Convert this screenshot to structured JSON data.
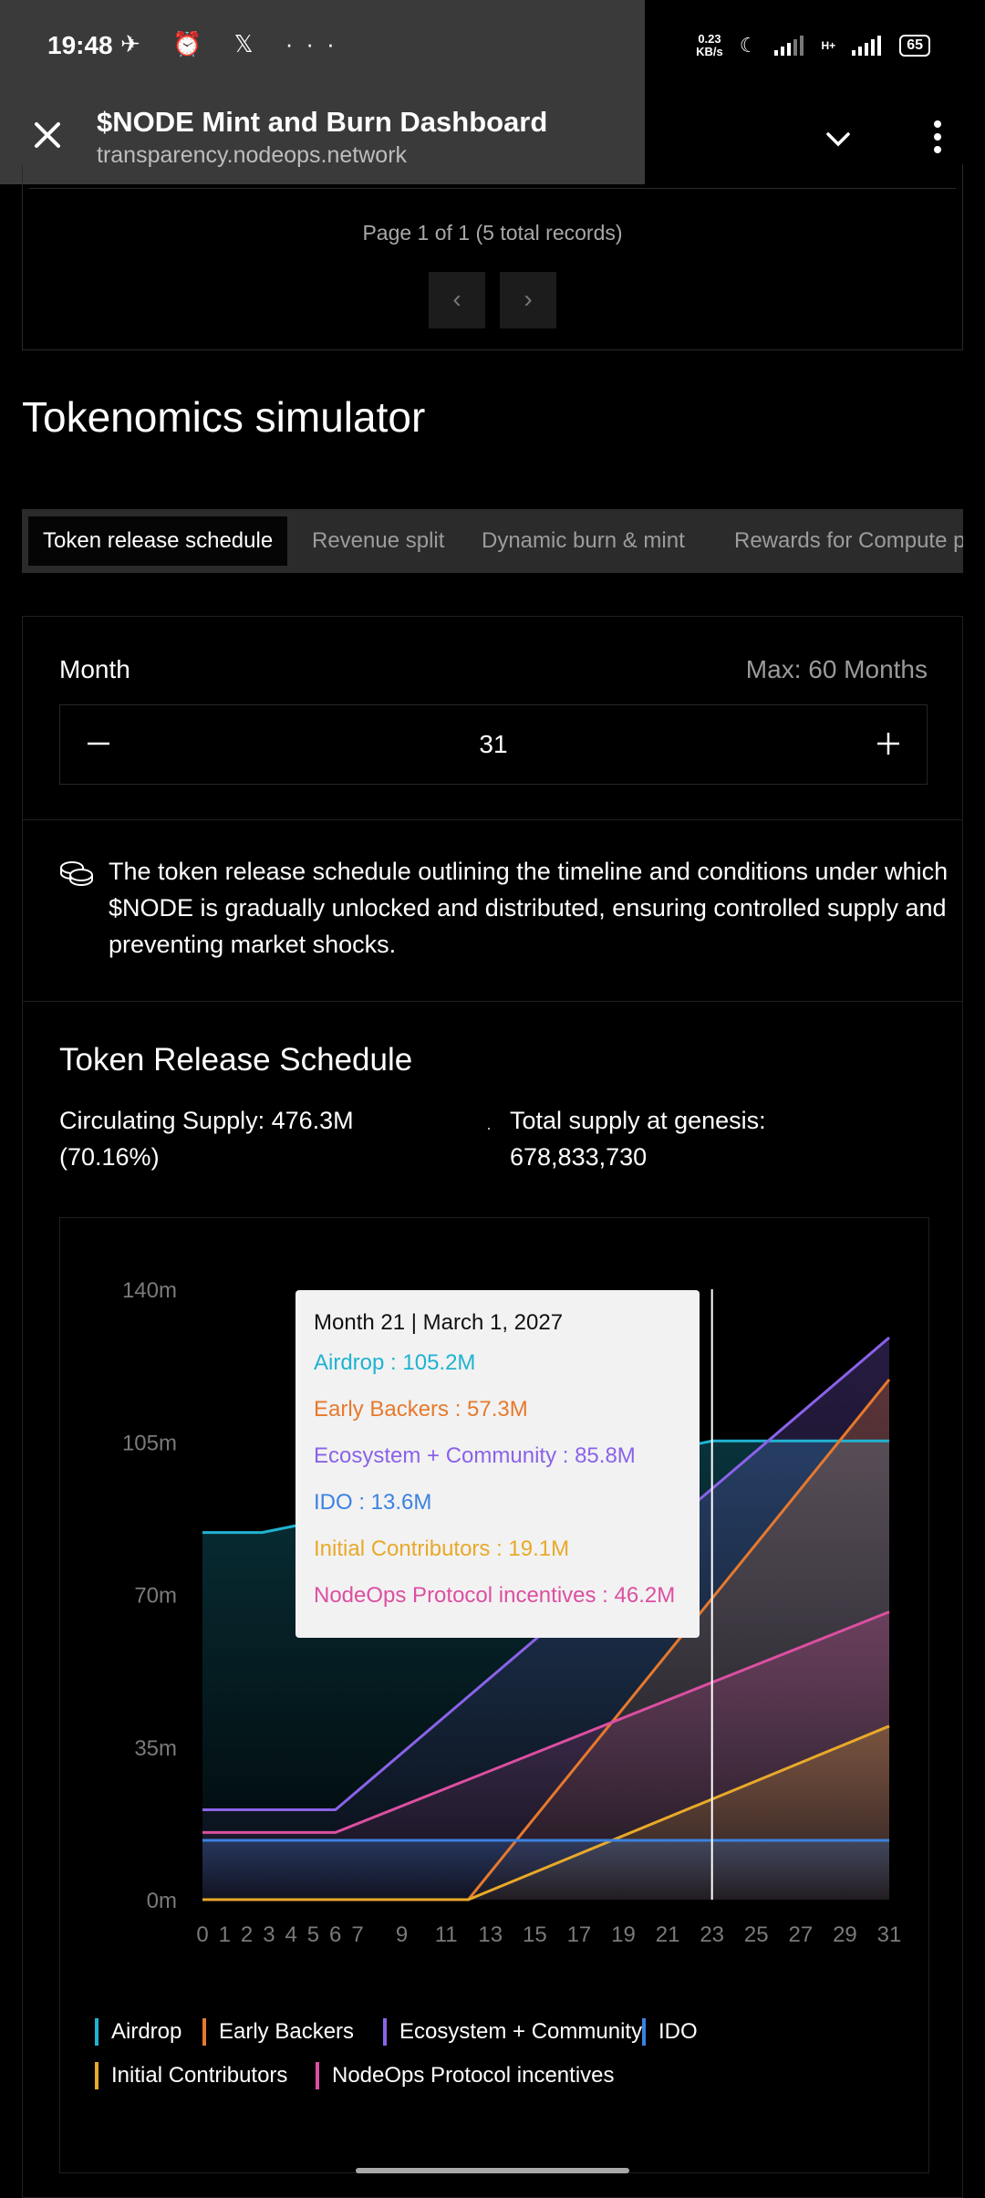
{
  "status_bar": {
    "time": "19:48",
    "icons": "✈ ⏰ 𝕏 ···",
    "speed_top": "0.23",
    "speed_bottom": "KB/s",
    "network": "H+",
    "battery": "65"
  },
  "browser": {
    "title": "$NODE Mint and Burn Dashboard",
    "url": "transparency.nodeops.network"
  },
  "pagination": {
    "info": "Page 1 of 1 (5 total records)",
    "prev": "‹",
    "next": "›"
  },
  "simulator": {
    "title": "Tokenomics simulator",
    "tabs": [
      "Token release schedule",
      "Revenue split",
      "Dynamic burn & mint",
      "Rewards for Compute p"
    ],
    "month_label": "Month",
    "month_max": "Max: 60 Months",
    "month_value": "31",
    "description": "The token release schedule outlining the timeline and conditions under which $NODE is gradually unlocked and distributed, ensuring controlled supply and preventing market shocks."
  },
  "release": {
    "title": "Token Release Schedule",
    "circulating": "Circulating Supply: 476.3M (70.16%)",
    "separator": "·",
    "genesis": "Total supply at genesis: 678,833,730"
  },
  "tooltip": {
    "header": "Month 21 | March 1, 2027",
    "rows": [
      {
        "text": "Airdrop : 105.2M",
        "color": "#1fb3d1"
      },
      {
        "text": "Early Backers : 57.3M",
        "color": "#e7792d"
      },
      {
        "text": "Ecosystem + Community : 85.8M",
        "color": "#8a63e8"
      },
      {
        "text": "IDO : 13.6M",
        "color": "#3b82e0"
      },
      {
        "text": "Initial Contributors : 19.1M",
        "color": "#e9a92a"
      },
      {
        "text": "NodeOps Protocol incentives : 46.2M",
        "color": "#dc4fa1"
      }
    ]
  },
  "chart_data": {
    "type": "area",
    "title": "Token Release Schedule",
    "x_ticks": [
      "0",
      "1",
      "2",
      "3",
      "4",
      "5",
      "6",
      "7",
      "9",
      "11",
      "13",
      "15",
      "17",
      "19",
      "21",
      "23",
      "25",
      "27",
      "29",
      "31"
    ],
    "y_ticks": [
      "140m",
      "105m",
      "70m",
      "35m",
      "0m"
    ],
    "ylim": [
      0,
      140
    ],
    "xlim": [
      0,
      31
    ],
    "hover_x": 23,
    "series": [
      {
        "name": "Airdrop",
        "color": "#1fb3d1",
        "x": [
          0,
          2.7,
          23,
          31
        ],
        "values": [
          84.2,
          84.2,
          105.2,
          105.2
        ]
      },
      {
        "name": "Early Backers",
        "color": "#e7792d",
        "x": [
          0,
          12,
          31
        ],
        "values": [
          0,
          0,
          119.3
        ]
      },
      {
        "name": "Ecosystem + Community",
        "color": "#8a63e8",
        "x": [
          0,
          6,
          31
        ],
        "values": [
          20.6,
          20.6,
          128.9
        ]
      },
      {
        "name": "IDO",
        "color": "#3b82e0",
        "x": [
          0,
          31
        ],
        "values": [
          13.6,
          13.6
        ]
      },
      {
        "name": "Initial Contributors",
        "color": "#e9a92a",
        "x": [
          0,
          12,
          31
        ],
        "values": [
          0,
          0,
          39.8
        ]
      },
      {
        "name": "NodeOps Protocol incentives",
        "color": "#dc4fa1",
        "x": [
          0,
          6,
          31
        ],
        "values": [
          15.4,
          15.4,
          66.0
        ]
      }
    ],
    "grid": false,
    "legend_position": "bottom"
  },
  "legend": [
    {
      "label": "Airdrop",
      "color": "#1fb3d1"
    },
    {
      "label": "Early Backers",
      "color": "#e7792d"
    },
    {
      "label": "Ecosystem + Community",
      "color": "#8a63e8"
    },
    {
      "label": "IDO",
      "color": "#3b82e0"
    },
    {
      "label": "Initial Contributors",
      "color": "#e9a92a"
    },
    {
      "label": "NodeOps Protocol incentives",
      "color": "#dc4fa1"
    }
  ]
}
